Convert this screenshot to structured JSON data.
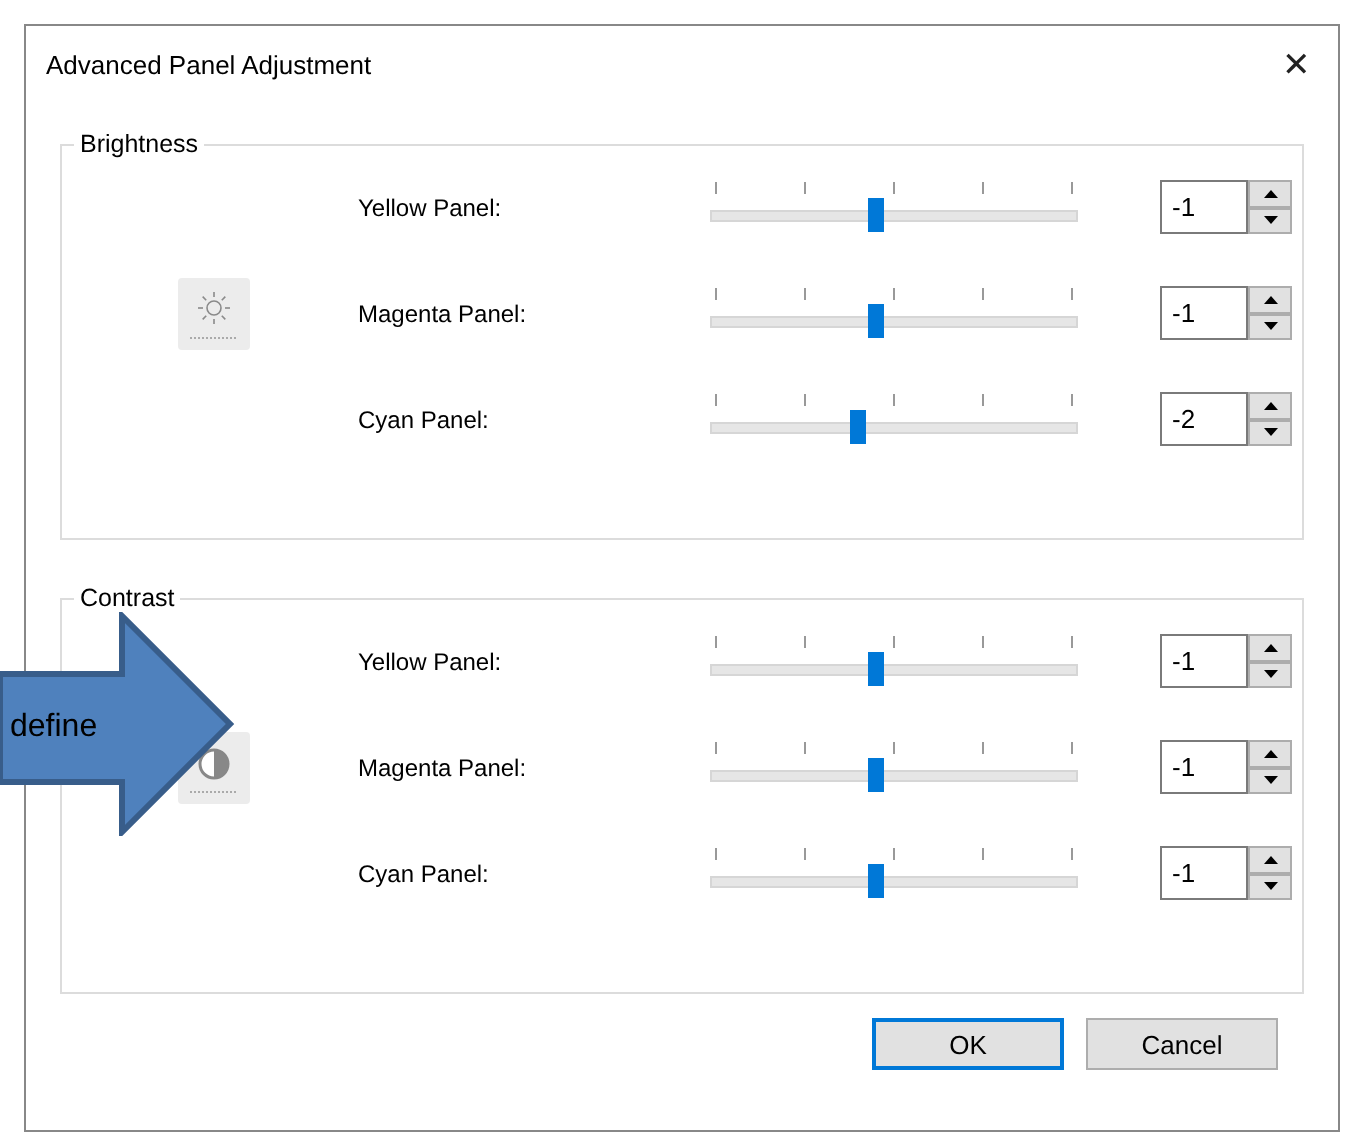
{
  "window": {
    "title": "Advanced Panel Adjustment",
    "close": "✕"
  },
  "groups": [
    {
      "title": "Brightness",
      "kind": "brightness",
      "rows": [
        {
          "label": "Yellow Panel:",
          "level": 0.45,
          "value": "-1"
        },
        {
          "label": "Magenta Panel:",
          "level": 0.45,
          "value": "-1"
        },
        {
          "label": "Cyan Panel:",
          "level": 0.4,
          "value": "-2"
        }
      ]
    },
    {
      "title": "Contrast",
      "kind": "contrast",
      "rows": [
        {
          "label": "Yellow Panel:",
          "level": 0.45,
          "value": "-1"
        },
        {
          "label": "Magenta Panel:",
          "level": 0.45,
          "value": "-1"
        },
        {
          "label": "Cyan Panel:",
          "level": 0.45,
          "value": "-1"
        }
      ]
    }
  ],
  "buttons": [
    {
      "label": "OK",
      "selected": true
    },
    {
      "label": "Cancel",
      "selected": false
    }
  ],
  "callout": {
    "text": "define"
  }
}
